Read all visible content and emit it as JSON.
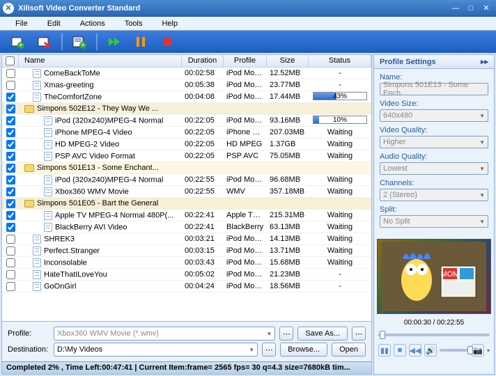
{
  "app": {
    "title": "Xilisoft Video Converter Standard"
  },
  "menu": [
    "File",
    "Edit",
    "Actions",
    "Tools",
    "Help"
  ],
  "columns": {
    "name": "Name",
    "duration": "Duration",
    "profile": "Profile",
    "size": "Size",
    "status": "Status"
  },
  "rows": [
    {
      "chk": false,
      "indent": 1,
      "type": "file",
      "name": "ComeBackToMe",
      "duration": "00:02:58",
      "profile": "iPod Movie",
      "size": "12.52MB",
      "status": "-"
    },
    {
      "chk": false,
      "indent": 1,
      "type": "file",
      "name": "Xmas-greeting",
      "duration": "00:05:38",
      "profile": "iPod Movie",
      "size": "23.77MB",
      "status": "-"
    },
    {
      "chk": true,
      "indent": 1,
      "type": "file",
      "name": "TheComfortZone",
      "duration": "00:04:08",
      "profile": "iPod Movie",
      "size": "17.44MB",
      "status_progress": 43
    },
    {
      "chk": true,
      "indent": 0,
      "type": "folder",
      "name": "Simpons 502E12 - They Way We ...",
      "duration": "",
      "profile": "",
      "size": "",
      "status": ""
    },
    {
      "chk": true,
      "indent": 2,
      "type": "file",
      "name": "iPod (320x240)MPEG-4 Normal",
      "duration": "00:22:05",
      "profile": "iPod Movie",
      "size": "93.16MB",
      "status_progress": 10
    },
    {
      "chk": true,
      "indent": 2,
      "type": "file",
      "name": "iPhone MPEG-4 Video",
      "duration": "00:22:05",
      "profile": "iPhone M...",
      "size": "207.03MB",
      "status": "Waiting"
    },
    {
      "chk": true,
      "indent": 2,
      "type": "file",
      "name": "HD MPEG-2 Video",
      "duration": "00:22:05",
      "profile": "HD MPEG",
      "size": "1.37GB",
      "status": "Waiting"
    },
    {
      "chk": true,
      "indent": 2,
      "type": "file",
      "name": "PSP AVC Video Format",
      "duration": "00:22:05",
      "profile": "PSP AVC",
      "size": "75.05MB",
      "status": "Waiting"
    },
    {
      "chk": true,
      "indent": 0,
      "type": "folder",
      "name": "Simpons 501E13 - Some Enchant...",
      "duration": "",
      "profile": "",
      "size": "",
      "status": "",
      "sel": true
    },
    {
      "chk": true,
      "indent": 2,
      "type": "file",
      "name": "iPod (320x240)MPEG-4 Normal",
      "duration": "00:22:55",
      "profile": "iPod Movie",
      "size": "96.68MB",
      "status": "Waiting"
    },
    {
      "chk": true,
      "indent": 2,
      "type": "file",
      "name": "Xbox360 WMV Movie",
      "duration": "00:22:55",
      "profile": "WMV",
      "size": "357.18MB",
      "status": "Waiting"
    },
    {
      "chk": true,
      "indent": 0,
      "type": "folder",
      "name": "Simpons 501E05 - Bart the General",
      "duration": "",
      "profile": "",
      "size": "",
      "status": ""
    },
    {
      "chk": true,
      "indent": 2,
      "type": "file",
      "name": "Apple TV MPEG-4 Normal 480P(...",
      "duration": "00:22:41",
      "profile": "Apple TV ...",
      "size": "215.31MB",
      "status": "Waiting"
    },
    {
      "chk": true,
      "indent": 2,
      "type": "file",
      "name": "BlackBerry AVI Video",
      "duration": "00:22:41",
      "profile": "BlackBerry",
      "size": "63.13MB",
      "status": "Waiting"
    },
    {
      "chk": false,
      "indent": 1,
      "type": "file",
      "name": "SHREK3",
      "duration": "00:03:21",
      "profile": "iPod Movie",
      "size": "14.13MB",
      "status": "Waiting"
    },
    {
      "chk": false,
      "indent": 1,
      "type": "file",
      "name": "Perfect.Stranger",
      "duration": "00:03:15",
      "profile": "iPod Movie",
      "size": "13.71MB",
      "status": "Waiting"
    },
    {
      "chk": false,
      "indent": 1,
      "type": "file",
      "name": "Inconsolable",
      "duration": "00:03:43",
      "profile": "iPod Movie",
      "size": "15.68MB",
      "status": "Waiting"
    },
    {
      "chk": false,
      "indent": 1,
      "type": "file",
      "name": "HateThatILoveYou",
      "duration": "00:05:02",
      "profile": "iPod Movie",
      "size": "21.23MB",
      "status": "-"
    },
    {
      "chk": false,
      "indent": 1,
      "type": "file",
      "name": "GoOnGirl",
      "duration": "00:04:24",
      "profile": "iPod Movie",
      "size": "18.56MB",
      "status": "-"
    }
  ],
  "bottom": {
    "profile_label": "Profile:",
    "profile_value": "Xbox360 WMV Movie (*.wmv)",
    "save_as": "Save As...",
    "destination_label": "Destination:",
    "destination_value": "D:\\My Videos",
    "browse": "Browse...",
    "open": "Open"
  },
  "statusbar": "Completed 2% , Time Left:00:47:41 | Current Item:frame= 2565 fps= 30 q=4.3 size=7680kB tim...",
  "settings": {
    "title": "Profile Settings",
    "name_label": "Name:",
    "name_value": "Simpons 501E13 - Some Ench",
    "video_size_label": "Video Size:",
    "video_size_value": "640x480",
    "video_quality_label": "Video Quality:",
    "video_quality_value": "Higher",
    "audio_quality_label": "Audio Quality:",
    "audio_quality_value": "Lowest",
    "channels_label": "Channels:",
    "channels_value": "2 (Stereo)",
    "split_label": "Split:",
    "split_value": "No Split"
  },
  "player": {
    "time": "00:00:30 / 00:22:55"
  }
}
